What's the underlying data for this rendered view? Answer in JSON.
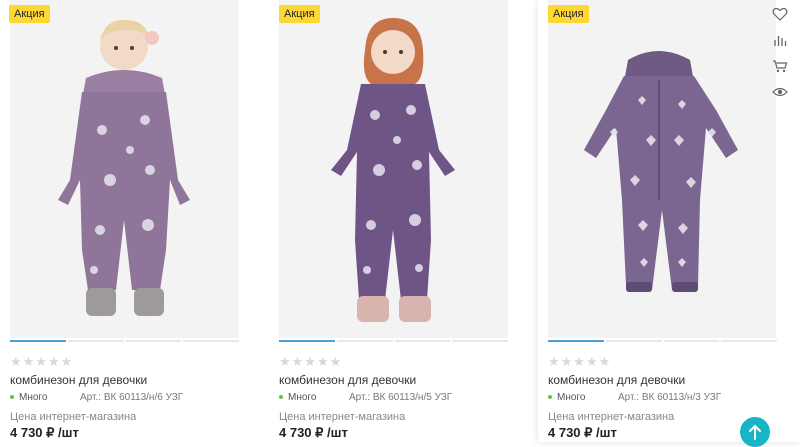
{
  "products": [
    {
      "badge": "Акция",
      "title": "комбинезон для девочки",
      "stock": "Много",
      "article": "Арт.: ВК 60113/н/6 УЗГ",
      "price_label": "Цена интернет-магазина",
      "price": "4 730 ₽ /шт",
      "stars": "★★★★★",
      "rating": 0
    },
    {
      "badge": "Акция",
      "title": "комбинезон для девочки",
      "stock": "Много",
      "article": "Арт.: ВК 60113/н/5 УЗГ",
      "price_label": "Цена интернет-магазина",
      "price": "4 730 ₽ /шт",
      "stars": "★★★★★",
      "rating": 0
    },
    {
      "badge": "Акция",
      "title": "комбинезон для девочки",
      "stock": "Много",
      "article": "Арт.: ВК 60113/н/3 УЗГ",
      "price_label": "Цена интернет-магазина",
      "price": "4 730 ₽ /шт",
      "stars": "★★★★★",
      "rating": 0
    }
  ],
  "card_actions": [
    "heart-icon",
    "compare-chart-icon",
    "cart-icon",
    "eye-icon"
  ],
  "colors": {
    "badge": "#fdd835",
    "accent": "#4a9fd8",
    "stock_dot": "#6bbf3a",
    "scroll_top": "#18b5c6",
    "suit_purple": "#8a6f95",
    "suit_dark": "#6e5586"
  }
}
